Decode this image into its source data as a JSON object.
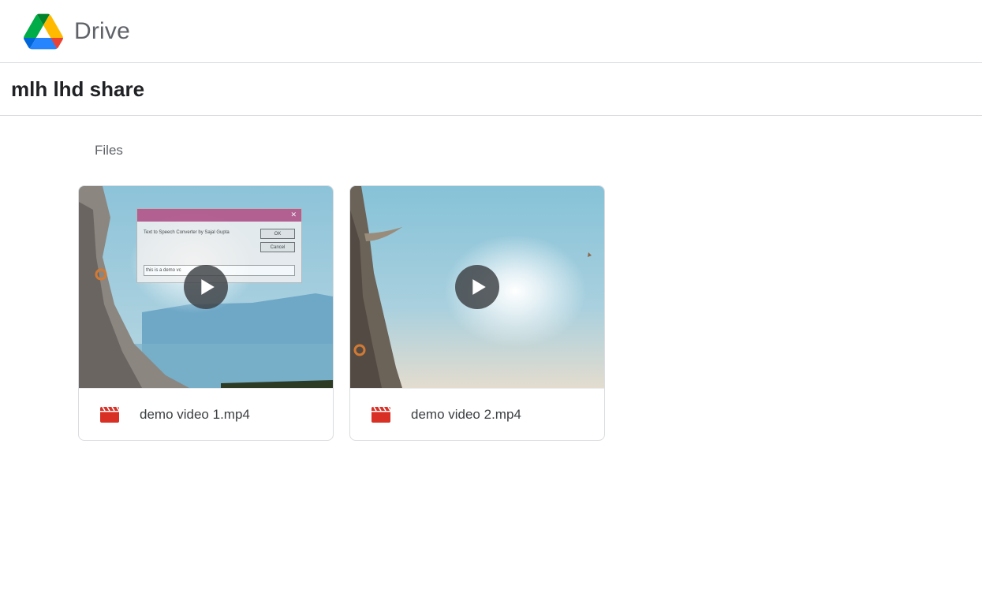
{
  "app": {
    "brand": "Drive",
    "logo_icon": "google-drive-logo-icon",
    "colors": {
      "green": "#1ea362",
      "blue": "#4285f4",
      "yellow": "#ffba00",
      "red": "#d93025"
    }
  },
  "folder": {
    "title": "mlh lhd share"
  },
  "files_section": {
    "label": "Files",
    "items": [
      {
        "name": "demo video 1.mp4",
        "type_icon": "video-file-icon",
        "play_icon": "play-icon",
        "thumbnail": {
          "dialog_text": "Text to Speech Converter by Sajal Gupta",
          "ok_label": "OK",
          "cancel_label": "Cancel",
          "field_value": "this is a demo vc"
        }
      },
      {
        "name": "demo video 2.mp4",
        "type_icon": "video-file-icon",
        "play_icon": "play-icon"
      }
    ]
  }
}
